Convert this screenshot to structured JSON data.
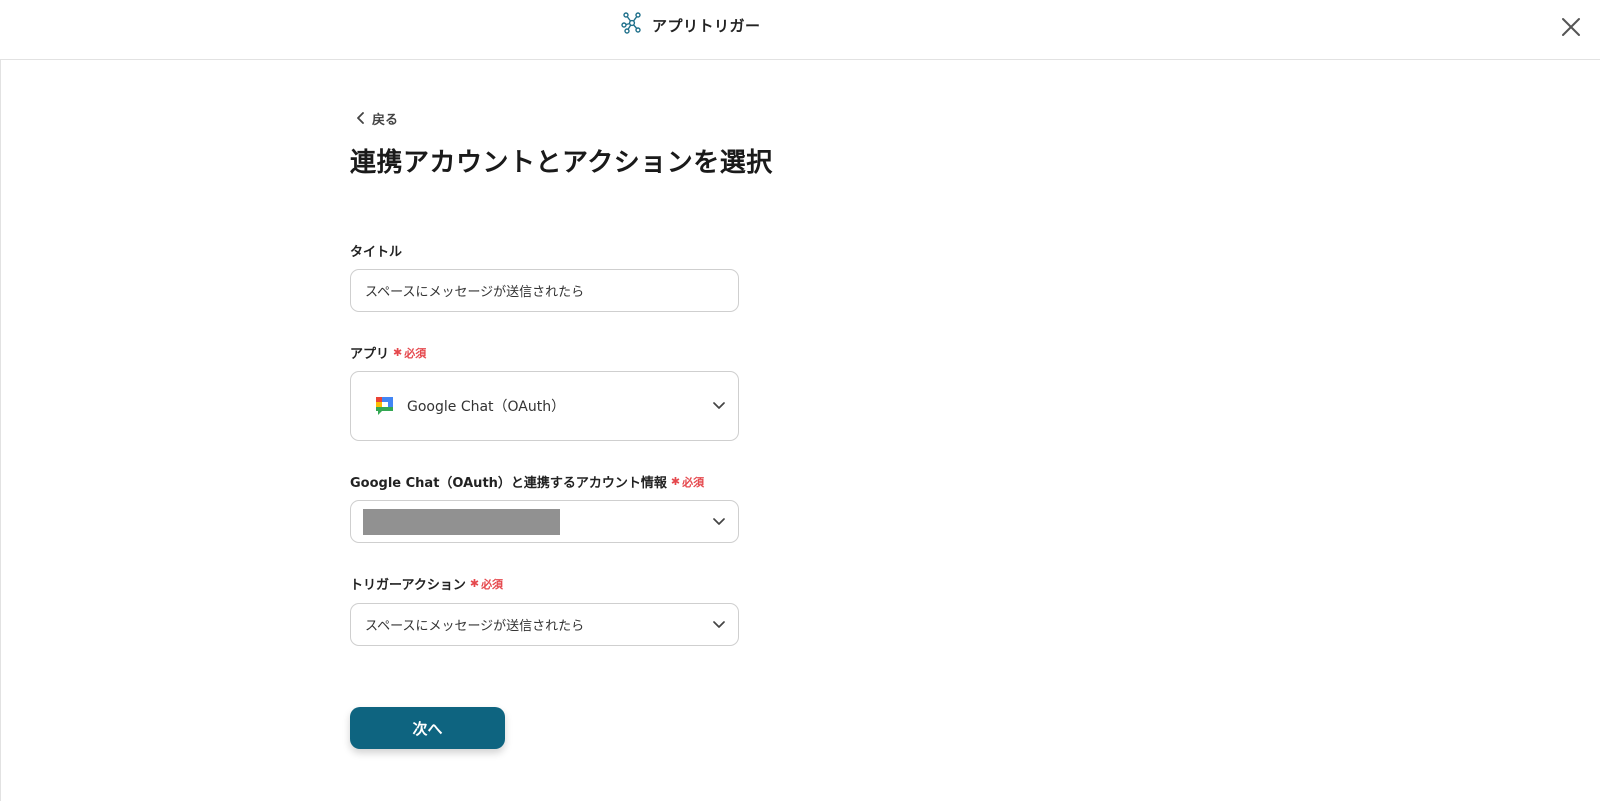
{
  "header": {
    "title": "アプリトリガー",
    "brand_icon": "network-nodes-icon",
    "close_icon": "close-icon",
    "accent_color": "#0e6480"
  },
  "back": {
    "label": "戻る"
  },
  "page": {
    "title": "連携アカウントとアクションを選択"
  },
  "required_label": "必須",
  "fields": {
    "title": {
      "label": "タイトル",
      "value": "スペースにメッセージが送信されたら"
    },
    "app": {
      "label": "アプリ",
      "value": "Google Chat（OAuth）",
      "icon": "google-chat-icon"
    },
    "account": {
      "label": "Google Chat（OAuth）と連携するアカウント情報",
      "value": ""
    },
    "trigger_action": {
      "label": "トリガーアクション",
      "value": "スペースにメッセージが送信されたら"
    }
  },
  "next_button": {
    "label": "次へ"
  },
  "colors": {
    "required": "#e5484d",
    "primary_button": "#0e6480",
    "border": "#cfcfcf",
    "redacted": "#919191"
  }
}
